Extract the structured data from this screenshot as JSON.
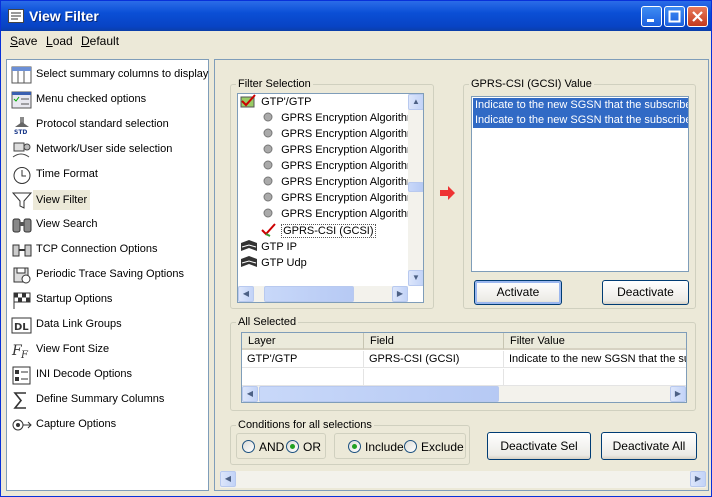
{
  "window": {
    "title": "View Filter"
  },
  "menu": [
    {
      "label": "Save",
      "accel": "S",
      "rest": "ave"
    },
    {
      "label": "Load",
      "accel": "L",
      "rest": "oad"
    },
    {
      "label": "Default",
      "accel": "D",
      "rest": "efault"
    }
  ],
  "nav": [
    {
      "label": "Select summary columns to display",
      "icon": "columns-icon"
    },
    {
      "label": "Menu checked options",
      "icon": "menu-checked-icon"
    },
    {
      "label": "Protocol standard selection",
      "icon": "std-icon"
    },
    {
      "label": "Network/User side selection",
      "icon": "network-icon"
    },
    {
      "label": "Time Format",
      "icon": "clock-icon"
    },
    {
      "label": "View Filter",
      "icon": "funnel-icon",
      "selected": true
    },
    {
      "label": "View Search",
      "icon": "binoculars-icon"
    },
    {
      "label": "TCP Connection Options",
      "icon": "tcp-icon"
    },
    {
      "label": "Periodic Trace Saving Options",
      "icon": "periodic-save-icon"
    },
    {
      "label": "Startup Options",
      "icon": "flag-icon"
    },
    {
      "label": "Data Link Groups",
      "icon": "datalink-icon"
    },
    {
      "label": "View Font Size",
      "icon": "font-size-icon"
    },
    {
      "label": "INI Decode Options",
      "icon": "ini-icon"
    },
    {
      "label": "Define Summary Columns",
      "icon": "sigma-icon"
    },
    {
      "label": "Capture Options",
      "icon": "capture-icon"
    }
  ],
  "filter_selection": {
    "legend": "Filter Selection",
    "tree": [
      {
        "label": "GTP'/GTP",
        "level": 0,
        "icon": "layer-checked-icon"
      },
      {
        "label": "GPRS Encryption Algorithm",
        "level": 1,
        "icon": "bullet-icon"
      },
      {
        "label": "GPRS Encryption Algorithm",
        "level": 1,
        "icon": "bullet-icon"
      },
      {
        "label": "GPRS Encryption Algorithm",
        "level": 1,
        "icon": "bullet-icon"
      },
      {
        "label": "GPRS Encryption Algorithm",
        "level": 1,
        "icon": "bullet-icon"
      },
      {
        "label": "GPRS Encryption Algorithm",
        "level": 1,
        "icon": "bullet-icon"
      },
      {
        "label": "GPRS Encryption Algorithm",
        "level": 1,
        "icon": "bullet-icon"
      },
      {
        "label": "GPRS Encryption Algorithm",
        "level": 1,
        "icon": "bullet-icon"
      },
      {
        "label": "GPRS-CSI (GCSI)",
        "level": 1,
        "icon": "check-icon",
        "boxed": true
      },
      {
        "label": "GTP IP",
        "level": 0,
        "icon": "book-icon"
      },
      {
        "label": "GTP Udp",
        "level": 0,
        "icon": "book-icon"
      }
    ]
  },
  "value_panel": {
    "legend": "GPRS-CSI (GCSI) Value",
    "values": [
      "Indicate to the new SGSN that the subscriber",
      "Indicate to the new SGSN that the subscriber"
    ],
    "activate_label": "Activate",
    "deactivate_label": "Deactivate"
  },
  "all_selected": {
    "legend": "All Selected",
    "columns": [
      "Layer",
      "Field",
      "Filter Value"
    ],
    "rows": [
      [
        "GTP'/GTP",
        "GPRS-CSI (GCSI)",
        "Indicate to the new SGSN that the su"
      ]
    ]
  },
  "conditions": {
    "legend": "Conditions for all selections",
    "and_label": "AND",
    "or_label": "OR",
    "include_label": "Include",
    "exclude_label": "Exclude",
    "logic_selected": "OR",
    "mode_selected": "Include"
  },
  "buttons": {
    "deactivate_sel": "Deactivate Sel",
    "deactivate_all": "Deactivate All"
  }
}
